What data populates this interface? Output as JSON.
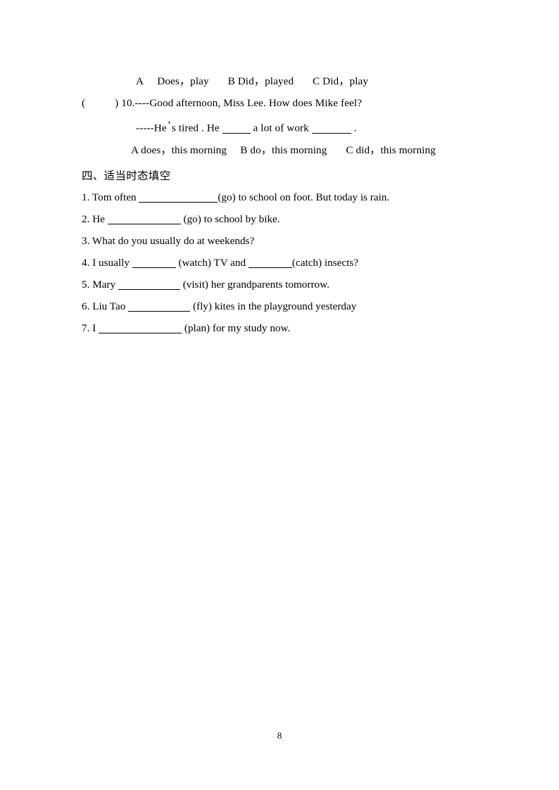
{
  "document": {
    "page_number": "8",
    "background_color": "#ffffff",
    "text_color": "#000000"
  },
  "carryover_question": {
    "options_line": "A  Does，play   B Did，played   C Did，play"
  },
  "question_10": {
    "bracket_open": "(",
    "bracket_close": ")",
    "number": "10.",
    "prompt_dashes": "----",
    "prompt": "Good afternoon, Miss Lee. How does Mike feel?",
    "answer_dashes": "-----",
    "answer_part1": "He",
    "answer_apostrophe": "’",
    "answer_part2": "s tired . He ",
    "answer_part3": " a lot of work ",
    "answer_part4": " .",
    "options": "A does，this morning  B do，this morning   C did，this morning"
  },
  "section_four": {
    "heading": "四、适当时态填空",
    "items": [
      {
        "number": "1.",
        "before": " Tom often ",
        "after": "(go) to school on foot. But today is rain."
      },
      {
        "number": "2.",
        "before": " He ",
        "after": " (go) to school by bike."
      },
      {
        "number": "3.",
        "before": " What do you usually do at weekends?",
        "after": ""
      },
      {
        "number": "4.",
        "before": " I usually ",
        "mid": " (watch) TV and ",
        "after": "(catch) insects?"
      },
      {
        "number": "5.",
        "before": " Mary ",
        "after": " (visit) her grandparents tomorrow."
      },
      {
        "number": "6.",
        "before": " Liu Tao ",
        "after": " (fly) kites in the playground yesterday"
      },
      {
        "number": "7.",
        "before": " I ",
        "after": " (plan) for my study now."
      }
    ]
  }
}
